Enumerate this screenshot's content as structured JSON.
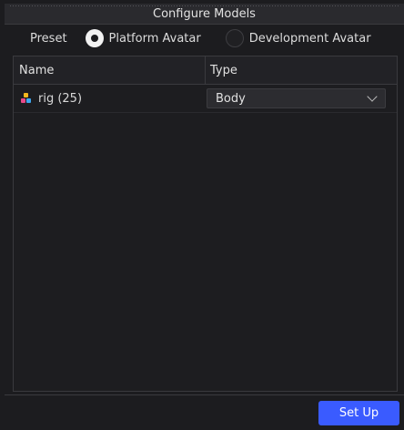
{
  "window": {
    "title": "Configure Models"
  },
  "preset": {
    "label": "Preset",
    "options": [
      {
        "label": "Platform Avatar",
        "selected": true
      },
      {
        "label": "Development Avatar",
        "selected": false
      }
    ]
  },
  "table": {
    "columns": [
      "Name",
      "Type"
    ],
    "rows": [
      {
        "name": "rig (25)",
        "icon": "model-icon",
        "type": "Body"
      }
    ]
  },
  "footer": {
    "setup_label": "Set Up"
  },
  "colors": {
    "accent": "#3a5bff",
    "background": "#1c1c1f"
  }
}
